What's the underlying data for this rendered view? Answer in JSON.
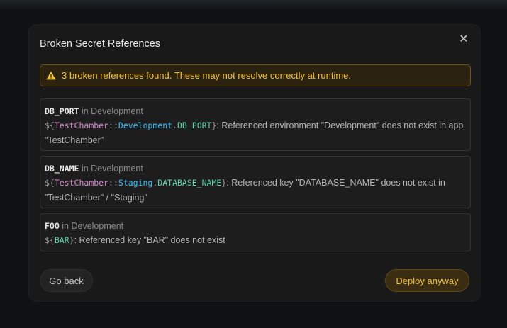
{
  "dialog": {
    "title": "Broken Secret References",
    "close_icon": "close-icon",
    "warning": {
      "icon": "warning-triangle-icon",
      "text": "3 broken references found. These may not resolve correctly at runtime.",
      "color": "#f0c23a"
    },
    "items": [
      {
        "key": "DB_PORT",
        "context": "in Development",
        "ref_open": "${",
        "ref_app": "TestChamber",
        "ref_sep1": "::",
        "ref_env": "Development",
        "ref_sep2": ".",
        "ref_key": "DB_PORT",
        "ref_close": "}",
        "message": ": Referenced environment \"Development\" does not exist in app \"TestChamber\""
      },
      {
        "key": "DB_NAME",
        "context": "in Development",
        "ref_open": "${",
        "ref_app": "TestChamber",
        "ref_sep1": "::",
        "ref_env": "Staging",
        "ref_sep2": ".",
        "ref_key": "DATABASE_NAME",
        "ref_close": "}",
        "message": ": Referenced key \"DATABASE_NAME\" does not exist in \"TestChamber\" / \"Staging\""
      },
      {
        "key": "FOO",
        "context": "in Development",
        "ref_open": "${",
        "ref_key": "BAR",
        "ref_close": "}",
        "message": ": Referenced key \"BAR\" does not exist"
      }
    ],
    "buttons": {
      "back_label": "Go back",
      "deploy_label": "Deploy anyway"
    }
  }
}
